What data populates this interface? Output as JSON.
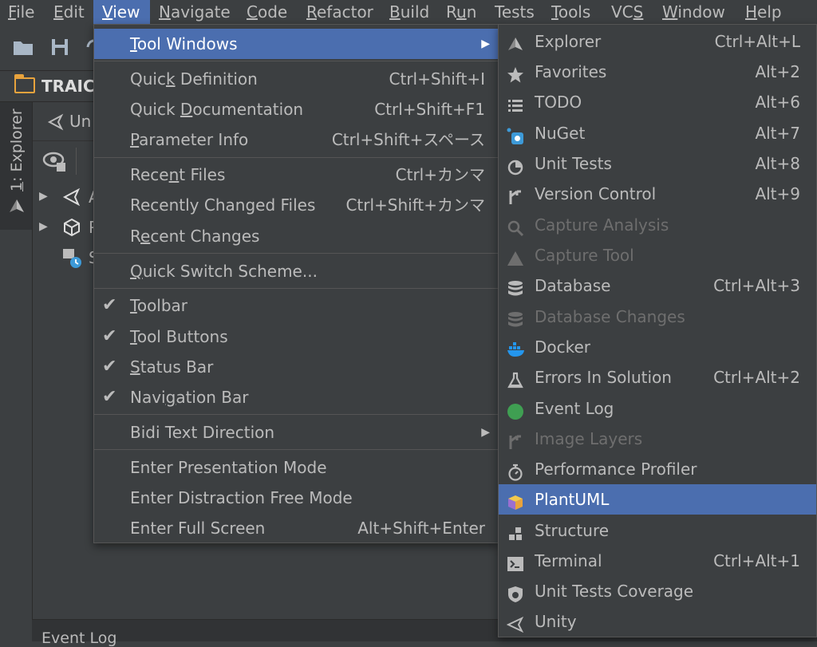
{
  "menubar": {
    "file": {
      "pre": "",
      "mn": "F",
      "post": "ile"
    },
    "edit": {
      "pre": "",
      "mn": "E",
      "post": "dit"
    },
    "view": {
      "pre": "",
      "mn": "V",
      "post": "iew"
    },
    "navigate": {
      "pre": "",
      "mn": "N",
      "post": "avigate"
    },
    "code": {
      "pre": "",
      "mn": "C",
      "post": "ode"
    },
    "refactor": {
      "pre": "",
      "mn": "R",
      "post": "efactor"
    },
    "build": {
      "pre": "",
      "mn": "B",
      "post": "uild"
    },
    "run": {
      "pre": "R",
      "mn": "u",
      "post": "n"
    },
    "tests": {
      "pre": "",
      "mn": "",
      "post": "Tests"
    },
    "tools": {
      "pre": "",
      "mn": "T",
      "post": "ools"
    },
    "vcs": {
      "pre": "VC",
      "mn": "S",
      "post": ""
    },
    "window": {
      "pre": "",
      "mn": "W",
      "post": "indow"
    },
    "help": {
      "pre": "",
      "mn": "H",
      "post": "elp"
    }
  },
  "navbar": {
    "project": "TRAICE"
  },
  "sidebar": {
    "explorer_tab": {
      "mn": "1",
      "post": ": Explorer"
    }
  },
  "panel": {
    "title": "Un",
    "rows": [
      {
        "text": "A"
      },
      {
        "text": "P"
      },
      {
        "text": "S"
      }
    ]
  },
  "bottom": {
    "event_log": "Event Log"
  },
  "view_menu": {
    "tool_windows": {
      "pre": "",
      "mn": "T",
      "post": "ool Windows"
    },
    "quick_definition": {
      "pre": "Quic",
      "mn": "k",
      "post": " Definition",
      "shortcut": "Ctrl+Shift+I"
    },
    "quick_documentation": {
      "pre": "Quick ",
      "mn": "D",
      "post": "ocumentation",
      "shortcut": "Ctrl+Shift+F1"
    },
    "parameter_info": {
      "pre": "",
      "mn": "P",
      "post": "arameter Info",
      "shortcut": "Ctrl+Shift+スペース"
    },
    "recent_files": {
      "pre": "Rece",
      "mn": "n",
      "post": "t Files",
      "shortcut": "Ctrl+カンマ"
    },
    "recently_changed_files": {
      "pre": "",
      "mn": "",
      "post": "Recently Changed Files",
      "shortcut": "Ctrl+Shift+カンマ"
    },
    "recent_changes": {
      "pre": "R",
      "mn": "e",
      "post": "cent Changes"
    },
    "quick_switch_scheme": {
      "pre": "",
      "mn": "Q",
      "post": "uick Switch Scheme..."
    },
    "toolbar": {
      "pre": "",
      "mn": "T",
      "post": "oolbar"
    },
    "tool_buttons": {
      "pre": "",
      "mn": "T",
      "post": "ool Buttons"
    },
    "status_bar": {
      "pre": "",
      "mn": "S",
      "post": "tatus Bar"
    },
    "navigation_bar": {
      "pre": "Navi",
      "mn": "g",
      "post": "ation Bar"
    },
    "bidi_text_direction": {
      "pre": "",
      "mn": "",
      "post": "Bidi Text Direction"
    },
    "presentation_mode": {
      "pre": "",
      "mn": "",
      "post": "Enter Presentation Mode"
    },
    "distraction_free_mode": {
      "pre": "",
      "mn": "",
      "post": "Enter Distraction Free Mode"
    },
    "full_screen": {
      "pre": "",
      "mn": "",
      "post": "Enter Full Screen",
      "shortcut": "Alt+Shift+Enter"
    }
  },
  "tool_windows_menu": [
    {
      "label": "Explorer",
      "shortcut": "Ctrl+Alt+L",
      "icon": "explorer-icon"
    },
    {
      "label": "Favorites",
      "shortcut": "Alt+2",
      "icon": "star-icon"
    },
    {
      "label": "TODO",
      "shortcut": "Alt+6",
      "icon": "todo-list-icon"
    },
    {
      "label": "NuGet",
      "shortcut": "Alt+7",
      "icon": "nuget-icon"
    },
    {
      "label": "Unit Tests",
      "shortcut": "Alt+8",
      "icon": "unit-tests-icon"
    },
    {
      "label": "Version Control",
      "shortcut": "Alt+9",
      "icon": "version-control-icon"
    },
    {
      "label": "Capture Analysis",
      "shortcut": "",
      "icon": "capture-analysis-icon"
    },
    {
      "label": "Capture Tool",
      "shortcut": "",
      "icon": "capture-tool-icon"
    },
    {
      "label": "Database",
      "shortcut": "Ctrl+Alt+3",
      "icon": "database-icon"
    },
    {
      "label": "Database Changes",
      "shortcut": "",
      "icon": "database-changes-icon"
    },
    {
      "label": "Docker",
      "shortcut": "",
      "icon": "docker-icon"
    },
    {
      "label": "Errors In Solution",
      "shortcut": "Ctrl+Alt+2",
      "icon": "errors-flask-icon"
    },
    {
      "label": "Event Log",
      "shortcut": "",
      "icon": "event-log-icon"
    },
    {
      "label": "Image Layers",
      "shortcut": "",
      "icon": "image-layers-icon"
    },
    {
      "label": "Performance Profiler",
      "shortcut": "",
      "icon": "stopwatch-icon"
    },
    {
      "label": "PlantUML",
      "shortcut": "",
      "icon": "plantuml-icon"
    },
    {
      "label": "Structure",
      "shortcut": "",
      "icon": "structure-icon"
    },
    {
      "label": "Terminal",
      "shortcut": "Ctrl+Alt+1",
      "icon": "terminal-icon"
    },
    {
      "label": "Unit Tests Coverage",
      "shortcut": "",
      "icon": "coverage-shield-icon"
    },
    {
      "label": "Unity",
      "shortcut": "",
      "icon": "unity-icon"
    }
  ],
  "colors": {
    "background": "#3c3f41",
    "selection": "#4b6eaf",
    "text": "#bbbbbb",
    "disabled_text": "#6e6e6e",
    "folder": "#e8a33d",
    "event_log_green": "#3f9f52"
  }
}
